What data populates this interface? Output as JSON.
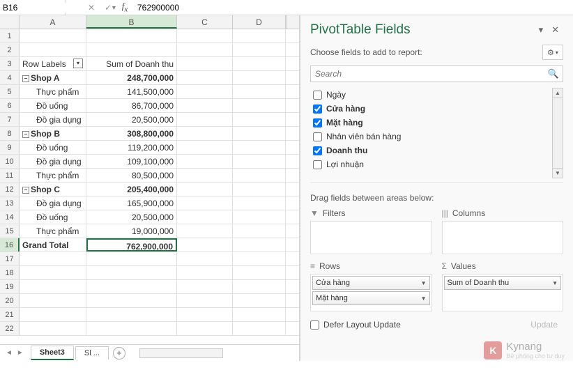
{
  "formula_bar": {
    "cell_ref": "B16",
    "formula": "762900000"
  },
  "columns": [
    "A",
    "B",
    "C",
    "D"
  ],
  "rows": [
    {
      "n": 1,
      "a": "",
      "b": ""
    },
    {
      "n": 2,
      "a": "",
      "b": ""
    },
    {
      "n": 3,
      "a": "Row Labels",
      "b": "Sum of Doanh thu",
      "header": true
    },
    {
      "n": 4,
      "a": "Shop A",
      "b": "248,700,000",
      "bold": true,
      "toggle": true
    },
    {
      "n": 5,
      "a": "Thực phẩm",
      "b": "141,500,000",
      "indent": true
    },
    {
      "n": 6,
      "a": "Đồ uống",
      "b": "86,700,000",
      "indent": true
    },
    {
      "n": 7,
      "a": "Đồ gia dụng",
      "b": "20,500,000",
      "indent": true
    },
    {
      "n": 8,
      "a": "Shop B",
      "b": "308,800,000",
      "bold": true,
      "toggle": true
    },
    {
      "n": 9,
      "a": "Đồ uống",
      "b": "119,200,000",
      "indent": true
    },
    {
      "n": 10,
      "a": "Đồ gia dụng",
      "b": "109,100,000",
      "indent": true
    },
    {
      "n": 11,
      "a": "Thực phẩm",
      "b": "80,500,000",
      "indent": true
    },
    {
      "n": 12,
      "a": "Shop C",
      "b": "205,400,000",
      "bold": true,
      "toggle": true
    },
    {
      "n": 13,
      "a": "Đồ gia dụng",
      "b": "165,900,000",
      "indent": true
    },
    {
      "n": 14,
      "a": "Đồ uống",
      "b": "20,500,000",
      "indent": true
    },
    {
      "n": 15,
      "a": "Thực phẩm",
      "b": "19,000,000",
      "indent": true
    },
    {
      "n": 16,
      "a": "Grand Total",
      "b": "762,900,000",
      "bold": true,
      "selected": true
    },
    {
      "n": 17,
      "a": "",
      "b": ""
    },
    {
      "n": 18,
      "a": "",
      "b": ""
    },
    {
      "n": 19,
      "a": "",
      "b": ""
    },
    {
      "n": 20,
      "a": "",
      "b": ""
    },
    {
      "n": 21,
      "a": "",
      "b": ""
    },
    {
      "n": 22,
      "a": "",
      "b": ""
    }
  ],
  "sheets": {
    "active": "Sheet3",
    "next": "Sl ..."
  },
  "pane": {
    "title": "PivotTable Fields",
    "subtitle": "Choose fields to add to report:",
    "search_placeholder": "Search",
    "fields": [
      {
        "label": "Ngày",
        "checked": false
      },
      {
        "label": "Cửa hàng",
        "checked": true
      },
      {
        "label": "Mặt hàng",
        "checked": true
      },
      {
        "label": "Nhân viên bán hàng",
        "checked": false
      },
      {
        "label": "Doanh thu",
        "checked": true
      },
      {
        "label": "Lợi nhuận",
        "checked": false
      }
    ],
    "drag_label": "Drag fields between areas below:",
    "filters_label": "Filters",
    "columns_label": "Columns",
    "rows_label": "Rows",
    "values_label": "Values",
    "rows_pills": [
      "Cửa hàng",
      "Mặt hàng"
    ],
    "values_pills": [
      "Sum of Doanh thu"
    ],
    "defer_label": "Defer Layout Update",
    "update_label": "Update"
  },
  "watermark": {
    "brand": "Kynang",
    "tag": "Bệ phóng cho tư duy"
  }
}
